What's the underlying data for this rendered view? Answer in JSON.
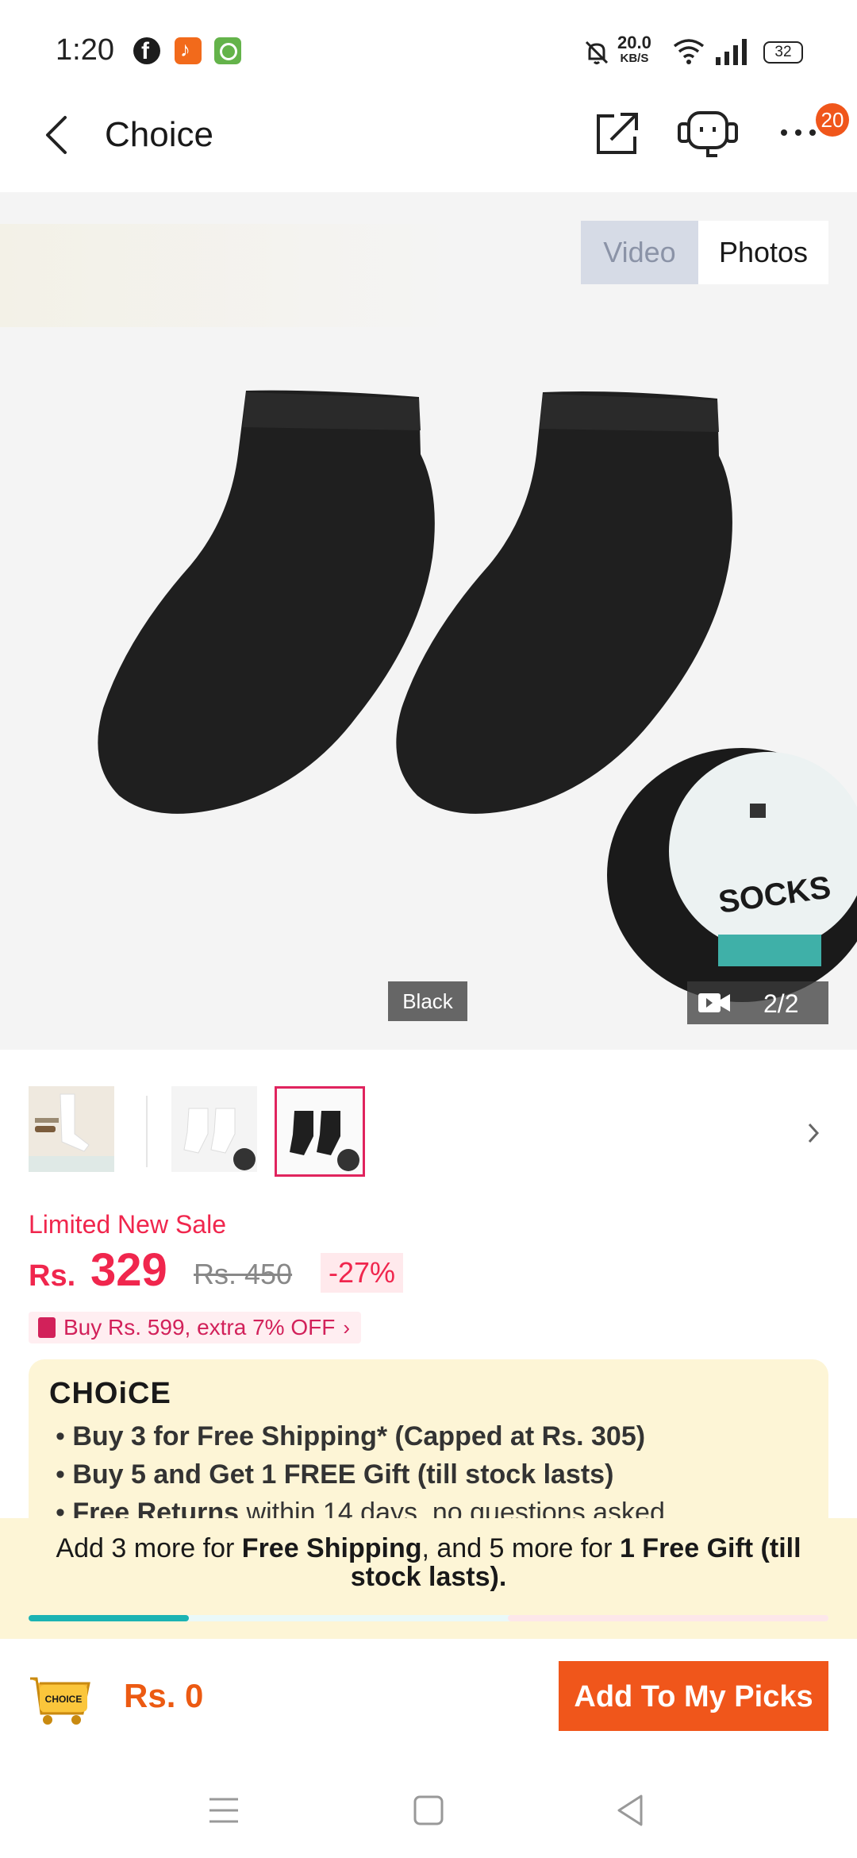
{
  "status_bar": {
    "time": "1:20",
    "net_speed_value": "20.0",
    "net_speed_unit": "KB/S",
    "battery": "32"
  },
  "header": {
    "title": "Choice",
    "badge_count": "20"
  },
  "gallery": {
    "toggle_video": "Video",
    "toggle_photos": "Photos",
    "variant_label": "Black",
    "counter": "2/2"
  },
  "price": {
    "sale_label": "Limited New Sale",
    "currency": "Rs.",
    "current": "329",
    "original": "Rs. 450",
    "discount": "-27%",
    "promo": "Buy Rs. 599, extra 7% OFF"
  },
  "choice": {
    "logo": "CHOiCE",
    "bullets": [
      {
        "bold": "Buy 3 for  Free Shipping* (Capped at Rs. 305)",
        "rest": ""
      },
      {
        "bold": "Buy 5 and Get 1 FREE Gift (till stock lasts)",
        "rest": ""
      },
      {
        "bold": "Free Returns",
        "rest": " within 14 days, no questions asked"
      }
    ]
  },
  "free_bar": {
    "t1": "Add 3 more for ",
    "t2": "Free Shipping",
    "t3": ", and 5 more for ",
    "t4": "1 Free Gift (till stock lasts)."
  },
  "cart": {
    "icon_label": "CHOICE",
    "total": "Rs. 0",
    "button": "Add To My Picks"
  },
  "colors": {
    "accent": "#f0561b",
    "price": "#f0264d",
    "choice_bg": "#fdf5d6",
    "progress": "#1bb3b3"
  },
  "progress_fraction": 0.2
}
